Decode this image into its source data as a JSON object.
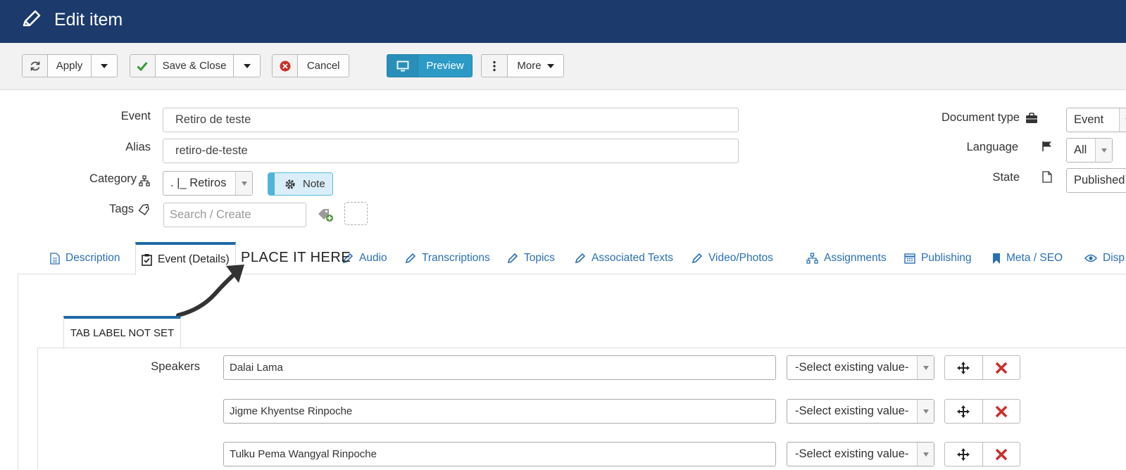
{
  "header": {
    "title": "Edit item"
  },
  "toolbar": {
    "apply": "Apply",
    "save_close": "Save & Close",
    "cancel": "Cancel",
    "preview": "Preview",
    "more": "More"
  },
  "form": {
    "event_label": "Event",
    "event_value": "Retiro de teste",
    "alias_label": "Alias",
    "alias_value": "retiro-de-teste",
    "category_label": "Category",
    "category_value": ". |_ Retiros",
    "note_label": "Note",
    "tags_label": "Tags",
    "tags_placeholder": "Search / Create"
  },
  "side": {
    "doctype_label": "Document type",
    "doctype_value": "Event",
    "language_label": "Language",
    "language_value": "All",
    "state_label": "State",
    "state_value": "Published"
  },
  "tabs": [
    {
      "label": "Description"
    },
    {
      "label": "Event (Details)"
    },
    {
      "label": "Audio"
    },
    {
      "label": "Transcriptions"
    },
    {
      "label": "Topics"
    },
    {
      "label": "Associated Texts"
    },
    {
      "label": "Video/Photos"
    },
    {
      "label": "Assignments"
    },
    {
      "label": "Publishing"
    },
    {
      "label": "Meta / SEO"
    },
    {
      "label": "Disp"
    }
  ],
  "annotation": "PLACE IT HERE",
  "subtab_label": "TAB LABEL NOT SET",
  "speakers": {
    "label": "Speakers",
    "select_placeholder": "-Select existing value-",
    "items": [
      "Dalai Lama",
      "Jigme Khyentse Rinpoche",
      "Tulku Pema Wangyal Rinpoche"
    ]
  },
  "colors": {
    "header": "#1c3a6b",
    "preview": "#2d9ac6",
    "tab_link": "#2a6fb5",
    "delete": "#c9302c",
    "save_check": "#3a9a3a"
  }
}
